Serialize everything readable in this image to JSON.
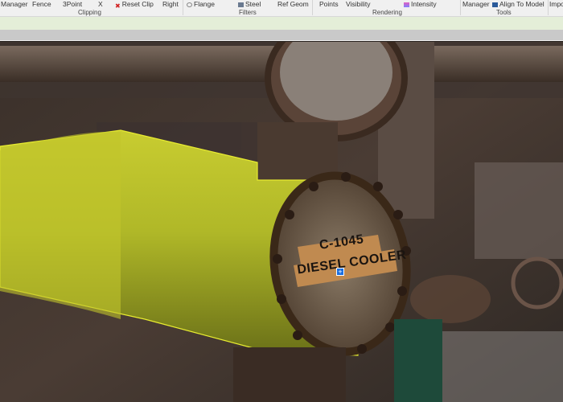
{
  "ribbon": {
    "items": [
      "Manager",
      "Fence",
      "3Point",
      "X",
      "Reset Clip",
      "Right",
      "Flange",
      "Steel",
      "Ref Geom",
      "Points",
      "Visibility",
      "Intensity",
      "Manager",
      "Align To Model",
      "Impo"
    ],
    "groups": [
      "Clipping",
      "Filters",
      "Rendering",
      "Tools"
    ]
  },
  "scene": {
    "tag_number": "C-1045",
    "tag_name": "DIESEL COOLER",
    "highlight_color": "#d4d62a"
  }
}
